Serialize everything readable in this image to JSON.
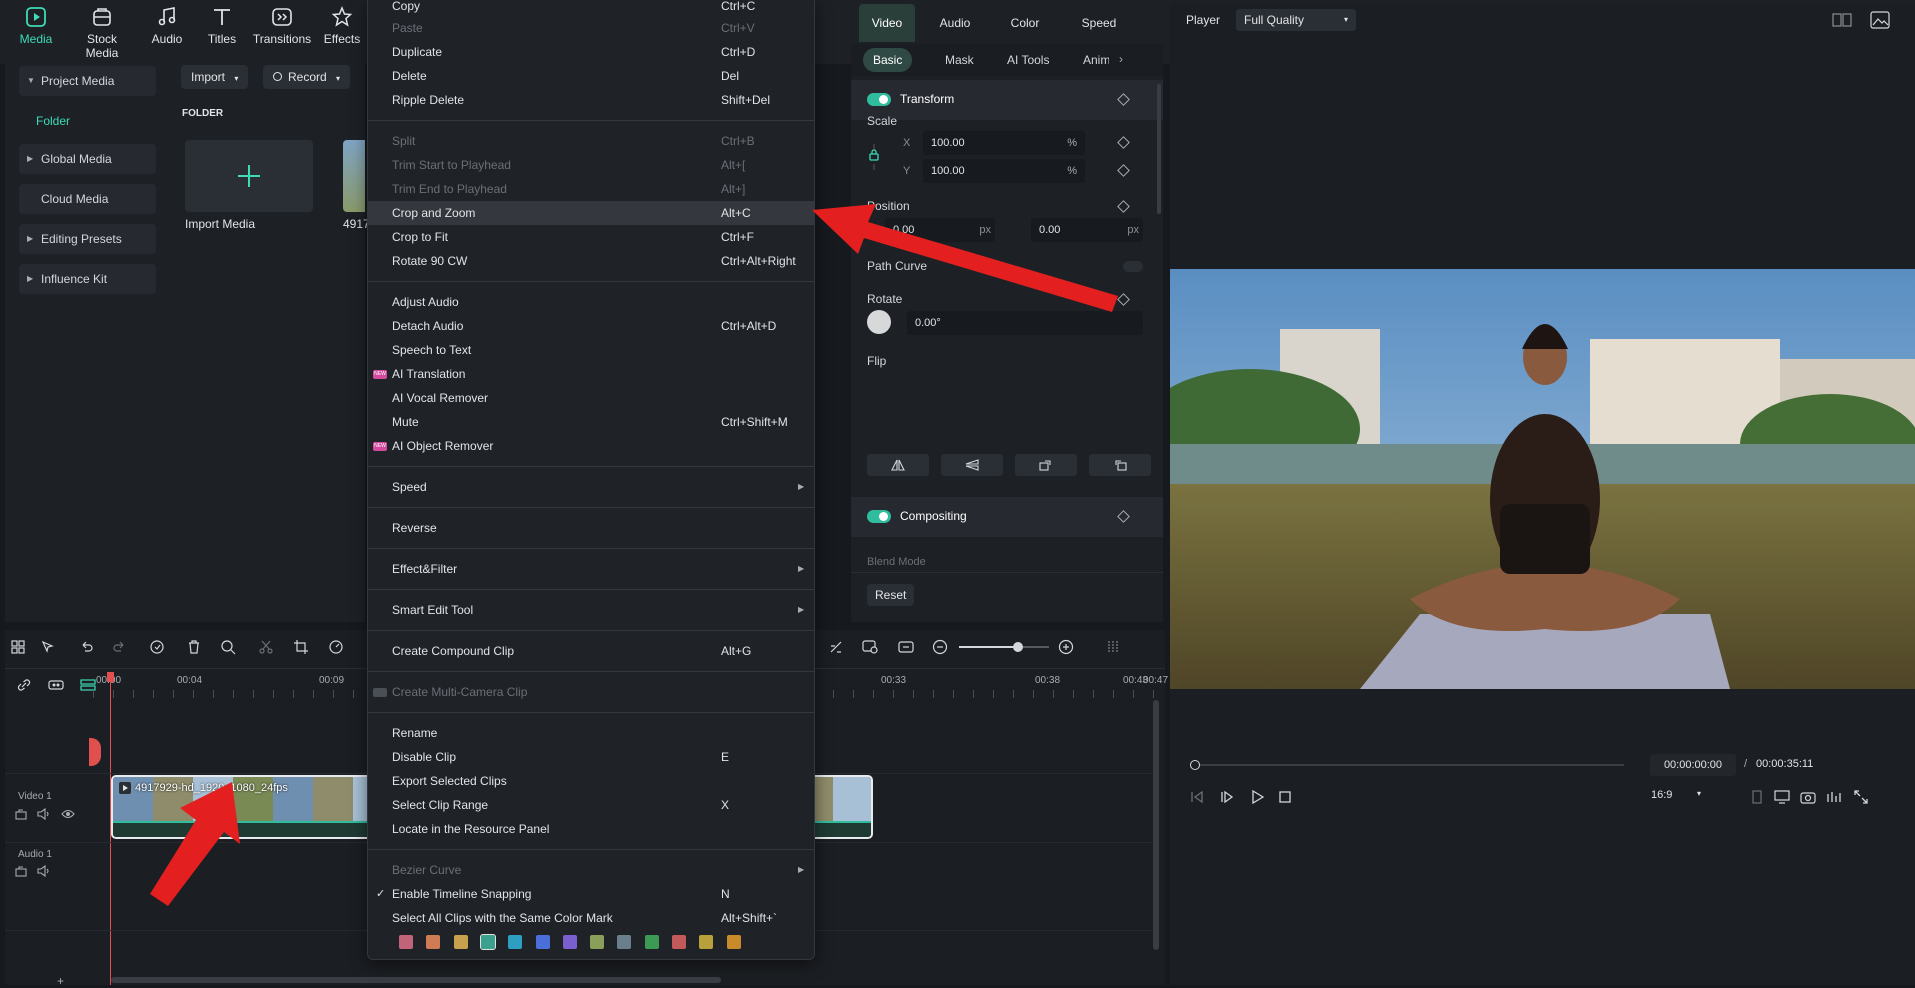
{
  "toolbar": {
    "items": [
      {
        "label": "Media",
        "icon": "media-icon",
        "active": true
      },
      {
        "label": "Stock Media",
        "icon": "stock-media-icon"
      },
      {
        "label": "Audio",
        "icon": "audio-icon"
      },
      {
        "label": "Titles",
        "icon": "titles-icon"
      },
      {
        "label": "Transitions",
        "icon": "transitions-icon"
      },
      {
        "label": "Effects",
        "icon": "effects-icon"
      }
    ]
  },
  "sidebar": {
    "items": [
      {
        "label": "Project Media",
        "expanded": true
      },
      {
        "label": "Folder",
        "active": true
      },
      {
        "label": "Global Media"
      },
      {
        "label": "Cloud Media"
      },
      {
        "label": "Editing Presets"
      },
      {
        "label": "Influence Kit"
      }
    ]
  },
  "media": {
    "import_label": "Import",
    "record_label": "Record",
    "folder_heading": "FOLDER",
    "import_media_label": "Import Media",
    "clip_label_partial": "4917"
  },
  "context_menu": {
    "copy": {
      "label": "Copy",
      "shortcut": "Ctrl+C"
    },
    "paste": {
      "label": "Paste",
      "shortcut": "Ctrl+V"
    },
    "duplicate": {
      "label": "Duplicate",
      "shortcut": "Ctrl+D"
    },
    "delete": {
      "label": "Delete",
      "shortcut": "Del"
    },
    "ripple_delete": {
      "label": "Ripple Delete",
      "shortcut": "Shift+Del"
    },
    "split": {
      "label": "Split",
      "shortcut": "Ctrl+B"
    },
    "trim_start": {
      "label": "Trim Start to Playhead",
      "shortcut": "Alt+["
    },
    "trim_end": {
      "label": "Trim End to Playhead",
      "shortcut": "Alt+]"
    },
    "crop_zoom": {
      "label": "Crop and Zoom",
      "shortcut": "Alt+C"
    },
    "crop_fit": {
      "label": "Crop to Fit",
      "shortcut": "Ctrl+F"
    },
    "rotate": {
      "label": "Rotate 90 CW",
      "shortcut": "Ctrl+Alt+Right"
    },
    "adjust_audio": {
      "label": "Adjust Audio"
    },
    "detach_audio": {
      "label": "Detach Audio",
      "shortcut": "Ctrl+Alt+D"
    },
    "speech_to_text": {
      "label": "Speech to Text"
    },
    "ai_translation": {
      "label": "AI Translation",
      "badge": "NEW"
    },
    "ai_vocal": {
      "label": "AI Vocal Remover"
    },
    "mute": {
      "label": "Mute",
      "shortcut": "Ctrl+Shift+M"
    },
    "ai_object": {
      "label": "AI Object Remover",
      "badge": "NEW"
    },
    "speed": {
      "label": "Speed"
    },
    "reverse": {
      "label": "Reverse"
    },
    "effect_filter": {
      "label": "Effect&Filter"
    },
    "smart_edit": {
      "label": "Smart Edit Tool"
    },
    "compound": {
      "label": "Create Compound Clip",
      "shortcut": "Alt+G"
    },
    "multicam": {
      "label": "Create Multi-Camera Clip"
    },
    "rename": {
      "label": "Rename"
    },
    "disable_clip": {
      "label": "Disable Clip",
      "shortcut": "E"
    },
    "export_selected": {
      "label": "Export Selected Clips"
    },
    "select_range": {
      "label": "Select Clip Range",
      "shortcut": "X"
    },
    "locate": {
      "label": "Locate in the Resource Panel"
    },
    "bezier": {
      "label": "Bezier Curve"
    },
    "snapping": {
      "label": "Enable Timeline Snapping",
      "shortcut": "N",
      "checked": true
    },
    "select_same_color": {
      "label": "Select All Clips with the Same Color Mark",
      "shortcut": "Alt+Shift+`"
    },
    "color_marks": [
      "#c1647a",
      "#cf7c55",
      "#c9a04b",
      "#3ba08e",
      "#2f9fc1",
      "#4a6fd8",
      "#7a5fcf",
      "#8aa05a",
      "#6a7f8c",
      "#3c9a55",
      "#c25a5a",
      "#b8a03a",
      "#c98a2a"
    ]
  },
  "properties": {
    "tabs": [
      "Video",
      "Audio",
      "Color",
      "Speed"
    ],
    "subtabs": [
      "Basic",
      "Mask",
      "AI Tools",
      "Anim"
    ],
    "transform_label": "Transform",
    "scale_label": "Scale",
    "scale_x": "100.00",
    "scale_y": "100.00",
    "percent": "%",
    "position_label": "Position",
    "pos_x": "0.00",
    "pos_y": "0.00",
    "px": "px",
    "x_axis": "X",
    "y_axis": "Y",
    "path_curve_label": "Path Curve",
    "rotate_label": "Rotate",
    "rotate_value": "0.00°",
    "flip_label": "Flip",
    "compositing_label": "Compositing",
    "blend_mode_label": "Blend Mode",
    "reset_label": "Reset"
  },
  "player": {
    "label": "Player",
    "quality": "Full Quality",
    "current_time": "00:00:00:00",
    "separator": "/",
    "total_time": "00:00:35:11",
    "aspect": "16:9"
  },
  "timeline": {
    "ruler": [
      "00:00",
      "00:04",
      "00:09",
      "00:33",
      "00:38",
      "00:43",
      "00:47"
    ],
    "video_track": "Video 1",
    "audio_track": "Audio 1",
    "clip_name": "4917929-hd_1920_1080_24fps",
    "zoom_level": 0.65
  }
}
